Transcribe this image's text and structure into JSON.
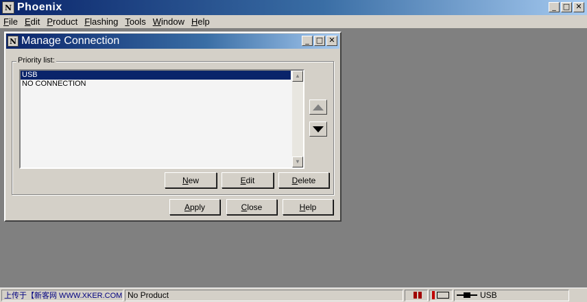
{
  "app": {
    "title": "Phoenix",
    "icon": "N"
  },
  "window_controls": {
    "minimize": "_",
    "maximize": "□",
    "close": "✕"
  },
  "menu": [
    "File",
    "Edit",
    "Product",
    "Flashing",
    "Tools",
    "Window",
    "Help"
  ],
  "dialog": {
    "title": "Manage Connection",
    "priority_label": "Priority list:",
    "items": [
      "USB",
      "NO CONNECTION"
    ],
    "selected_index": 0,
    "buttons": {
      "new": "New",
      "edit": "Edit",
      "delete": "Delete",
      "apply": "Apply",
      "close": "Close",
      "help": "Help"
    }
  },
  "status": {
    "left": "上传于【新客网 WWW.XKER.COM】",
    "product": "No Product",
    "connection": "USB"
  },
  "colors": {
    "title_active": "#0a246a",
    "face": "#d4d0c8",
    "desktop": "#808080"
  }
}
